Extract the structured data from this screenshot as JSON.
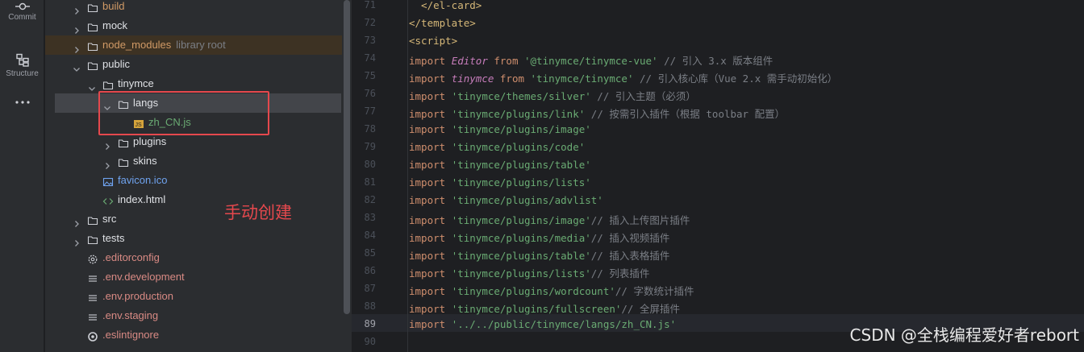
{
  "activity_bar": {
    "items": [
      {
        "label": "Commit",
        "icon": "commit-icon"
      },
      {
        "label": "Structure",
        "icon": "structure-icon"
      },
      {
        "label": "",
        "icon": "more-icon"
      }
    ]
  },
  "tree": {
    "rows": [
      {
        "name": "build",
        "hint": "",
        "kind": "folder",
        "expanded": false,
        "color": "orange"
      },
      {
        "name": "mock",
        "hint": "",
        "kind": "folder",
        "expanded": false,
        "color": "default"
      },
      {
        "name": "node_modules",
        "hint": "library root",
        "kind": "folder",
        "expanded": false,
        "color": "orange"
      },
      {
        "name": "public",
        "hint": "",
        "kind": "folder",
        "expanded": true,
        "color": "default"
      },
      {
        "name": "tinymce",
        "hint": "",
        "kind": "folder",
        "expanded": true,
        "color": "default"
      },
      {
        "name": "langs",
        "hint": "",
        "kind": "folder",
        "expanded": true,
        "color": "default",
        "selected": true
      },
      {
        "name": "zh_CN.js",
        "hint": "",
        "kind": "js",
        "color": "green"
      },
      {
        "name": "plugins",
        "hint": "",
        "kind": "folder",
        "expanded": false,
        "color": "default"
      },
      {
        "name": "skins",
        "hint": "",
        "kind": "folder",
        "expanded": false,
        "color": "default"
      },
      {
        "name": "favicon.ico",
        "hint": "",
        "kind": "image",
        "color": "blue"
      },
      {
        "name": "index.html",
        "hint": "",
        "kind": "html",
        "color": "default"
      },
      {
        "name": "src",
        "hint": "",
        "kind": "folder",
        "expanded": false,
        "color": "default"
      },
      {
        "name": "tests",
        "hint": "",
        "kind": "folder",
        "expanded": false,
        "color": "default"
      },
      {
        "name": ".editorconfig",
        "hint": "",
        "kind": "config",
        "color": "red"
      },
      {
        "name": ".env.development",
        "hint": "",
        "kind": "text",
        "color": "red"
      },
      {
        "name": ".env.production",
        "hint": "",
        "kind": "text",
        "color": "red"
      },
      {
        "name": ".env.staging",
        "hint": "",
        "kind": "text",
        "color": "red"
      },
      {
        "name": ".eslintignore",
        "hint": "",
        "kind": "ignore",
        "color": "red"
      }
    ]
  },
  "annotation": {
    "text": "手动创建",
    "color": "#e5484d"
  },
  "editor": {
    "current_line": 89,
    "lines": [
      {
        "n": 71,
        "tokens": [
          [
            "tag",
            "  </el-card>"
          ]
        ]
      },
      {
        "n": 72,
        "tokens": [
          [
            "tag",
            "</template>"
          ]
        ]
      },
      {
        "n": 73,
        "tokens": [
          [
            "tag",
            "<script>"
          ]
        ]
      },
      {
        "n": 74,
        "tokens": [
          [
            "kw",
            "import "
          ],
          [
            "ital",
            "Editor"
          ],
          [
            "kw",
            " from "
          ],
          [
            "str",
            "'@tinymce/tinymce-vue'"
          ],
          [
            "cmt",
            " // 引入 3.x 版本组件"
          ]
        ]
      },
      {
        "n": 75,
        "tokens": [
          [
            "kw",
            "import "
          ],
          [
            "ital",
            "tinymce"
          ],
          [
            "kw",
            " from "
          ],
          [
            "str",
            "'tinymce/tinymce'"
          ],
          [
            "cmt",
            " // 引入核心库（Vue 2.x 需手动初始化）"
          ]
        ]
      },
      {
        "n": 76,
        "tokens": [
          [
            "kw",
            "import "
          ],
          [
            "str",
            "'tinymce/themes/silver'"
          ],
          [
            "cmt",
            " // 引入主题（必须）"
          ]
        ]
      },
      {
        "n": 77,
        "tokens": [
          [
            "kw",
            "import "
          ],
          [
            "str",
            "'tinymce/plugins/link'"
          ],
          [
            "cmt",
            " // 按需引入插件（根据 toolbar 配置）"
          ]
        ]
      },
      {
        "n": 78,
        "tokens": [
          [
            "kw",
            "import "
          ],
          [
            "str",
            "'tinymce/plugins/image'"
          ]
        ]
      },
      {
        "n": 79,
        "tokens": [
          [
            "kw",
            "import "
          ],
          [
            "str",
            "'tinymce/plugins/code'"
          ]
        ]
      },
      {
        "n": 80,
        "tokens": [
          [
            "kw",
            "import "
          ],
          [
            "str",
            "'tinymce/plugins/table'"
          ]
        ]
      },
      {
        "n": 81,
        "tokens": [
          [
            "kw",
            "import "
          ],
          [
            "str",
            "'tinymce/plugins/lists'"
          ]
        ]
      },
      {
        "n": 82,
        "tokens": [
          [
            "kw",
            "import "
          ],
          [
            "str",
            "'tinymce/plugins/advlist'"
          ]
        ]
      },
      {
        "n": 83,
        "tokens": [
          [
            "kw",
            "import "
          ],
          [
            "str",
            "'tinymce/plugins/image'"
          ],
          [
            "cmt",
            "// 插入上传图片插件"
          ]
        ]
      },
      {
        "n": 84,
        "tokens": [
          [
            "kw",
            "import "
          ],
          [
            "str",
            "'tinymce/plugins/media'"
          ],
          [
            "cmt",
            "// 插入视频插件"
          ]
        ]
      },
      {
        "n": 85,
        "tokens": [
          [
            "kw",
            "import "
          ],
          [
            "str",
            "'tinymce/plugins/table'"
          ],
          [
            "cmt",
            "// 插入表格插件"
          ]
        ]
      },
      {
        "n": 86,
        "tokens": [
          [
            "kw",
            "import "
          ],
          [
            "str",
            "'tinymce/plugins/lists'"
          ],
          [
            "cmt",
            "// 列表插件"
          ]
        ]
      },
      {
        "n": 87,
        "tokens": [
          [
            "kw",
            "import "
          ],
          [
            "str",
            "'tinymce/plugins/wordcount'"
          ],
          [
            "cmt",
            "// 字数统计插件"
          ]
        ]
      },
      {
        "n": 88,
        "tokens": [
          [
            "kw",
            "import "
          ],
          [
            "str",
            "'tinymce/plugins/fullscreen'"
          ],
          [
            "cmt",
            "// 全屏插件"
          ]
        ]
      },
      {
        "n": 89,
        "tokens": [
          [
            "kw",
            "import "
          ],
          [
            "str",
            "'../../public/tinymce/langs/zh_CN.js'"
          ]
        ]
      },
      {
        "n": 90,
        "tokens": []
      }
    ]
  },
  "watermark": {
    "text": "CSDN @全栈编程爱好者rebort"
  }
}
